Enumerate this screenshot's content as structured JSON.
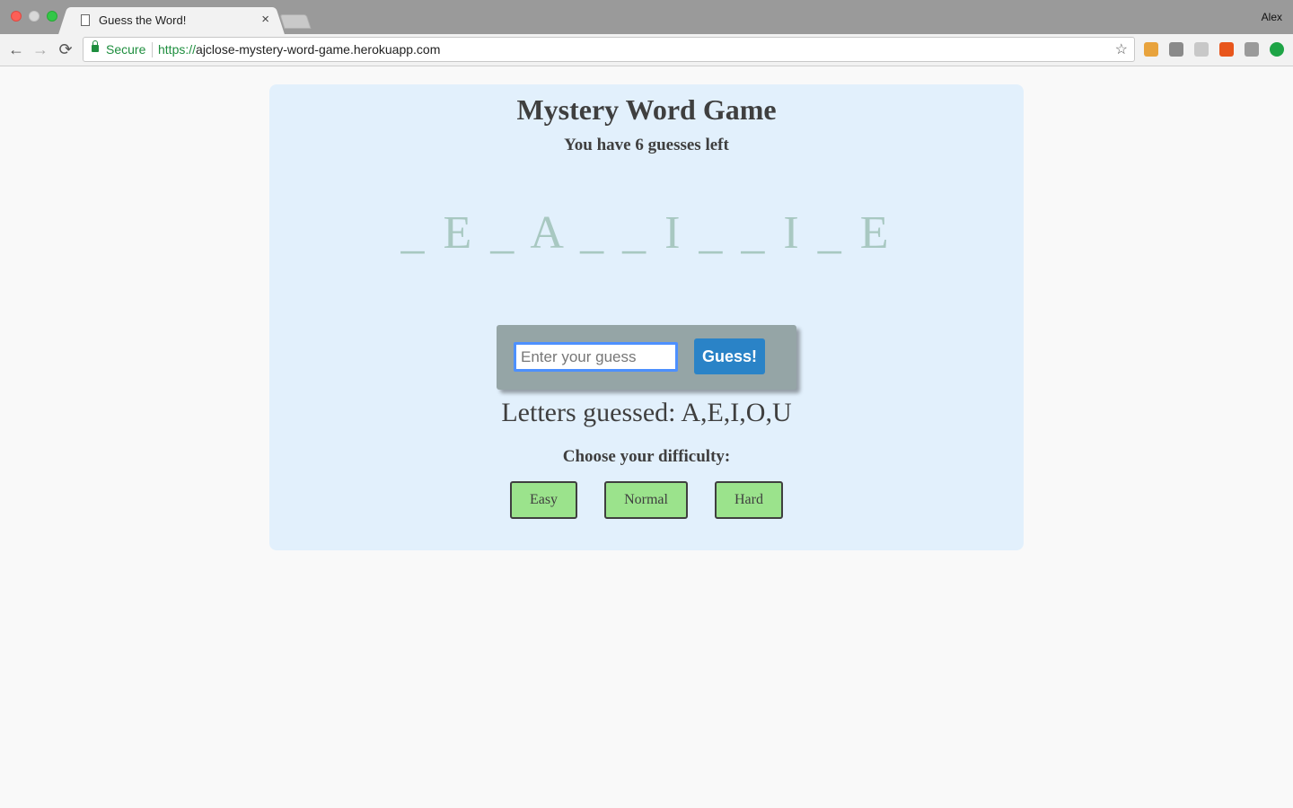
{
  "browser": {
    "tab_title": "Guess the Word!",
    "tab_close": "×",
    "profile_name": "Alex",
    "secure_label": "Secure",
    "url_scheme": "https://",
    "url_host": "ajclose-mystery-word-game.herokuapp.com",
    "nav": {
      "back": "←",
      "forward": "→",
      "reload": "⟳"
    },
    "star": "☆",
    "extensions": [
      {
        "name": "tag-extension-icon",
        "color": "#e8a33d"
      },
      {
        "name": "bug-extension-icon",
        "color": "#8a8a8a"
      },
      {
        "name": "link-extension-icon",
        "color": "#c8c8c8"
      },
      {
        "name": "percent-extension-icon",
        "color": "#e8561c"
      },
      {
        "name": "camera-extension-icon",
        "color": "#9a9a9a"
      },
      {
        "name": "upload-extension-icon",
        "color": "#1ea446"
      }
    ]
  },
  "game": {
    "title": "Mystery Word Game",
    "guesses_left": "You have 6 guesses left",
    "word_display": "_ E _ A _ _ I _ _ I _ E",
    "guess_input_placeholder": "Enter your guess",
    "guess_button": "Guess!",
    "letters_guessed_label": "Letters guessed: ",
    "letters_guessed_value": "A,E,I,O,U",
    "difficulty_label": "Choose your difficulty:",
    "difficulty_options": [
      "Easy",
      "Normal",
      "Hard"
    ]
  },
  "colors": {
    "card_bg": "#e2f0fc",
    "word_color": "#a8c8c1",
    "guess_button": "#2a83c7",
    "difficulty_button": "#9be38c",
    "guess_panel": "#95a5a6"
  }
}
